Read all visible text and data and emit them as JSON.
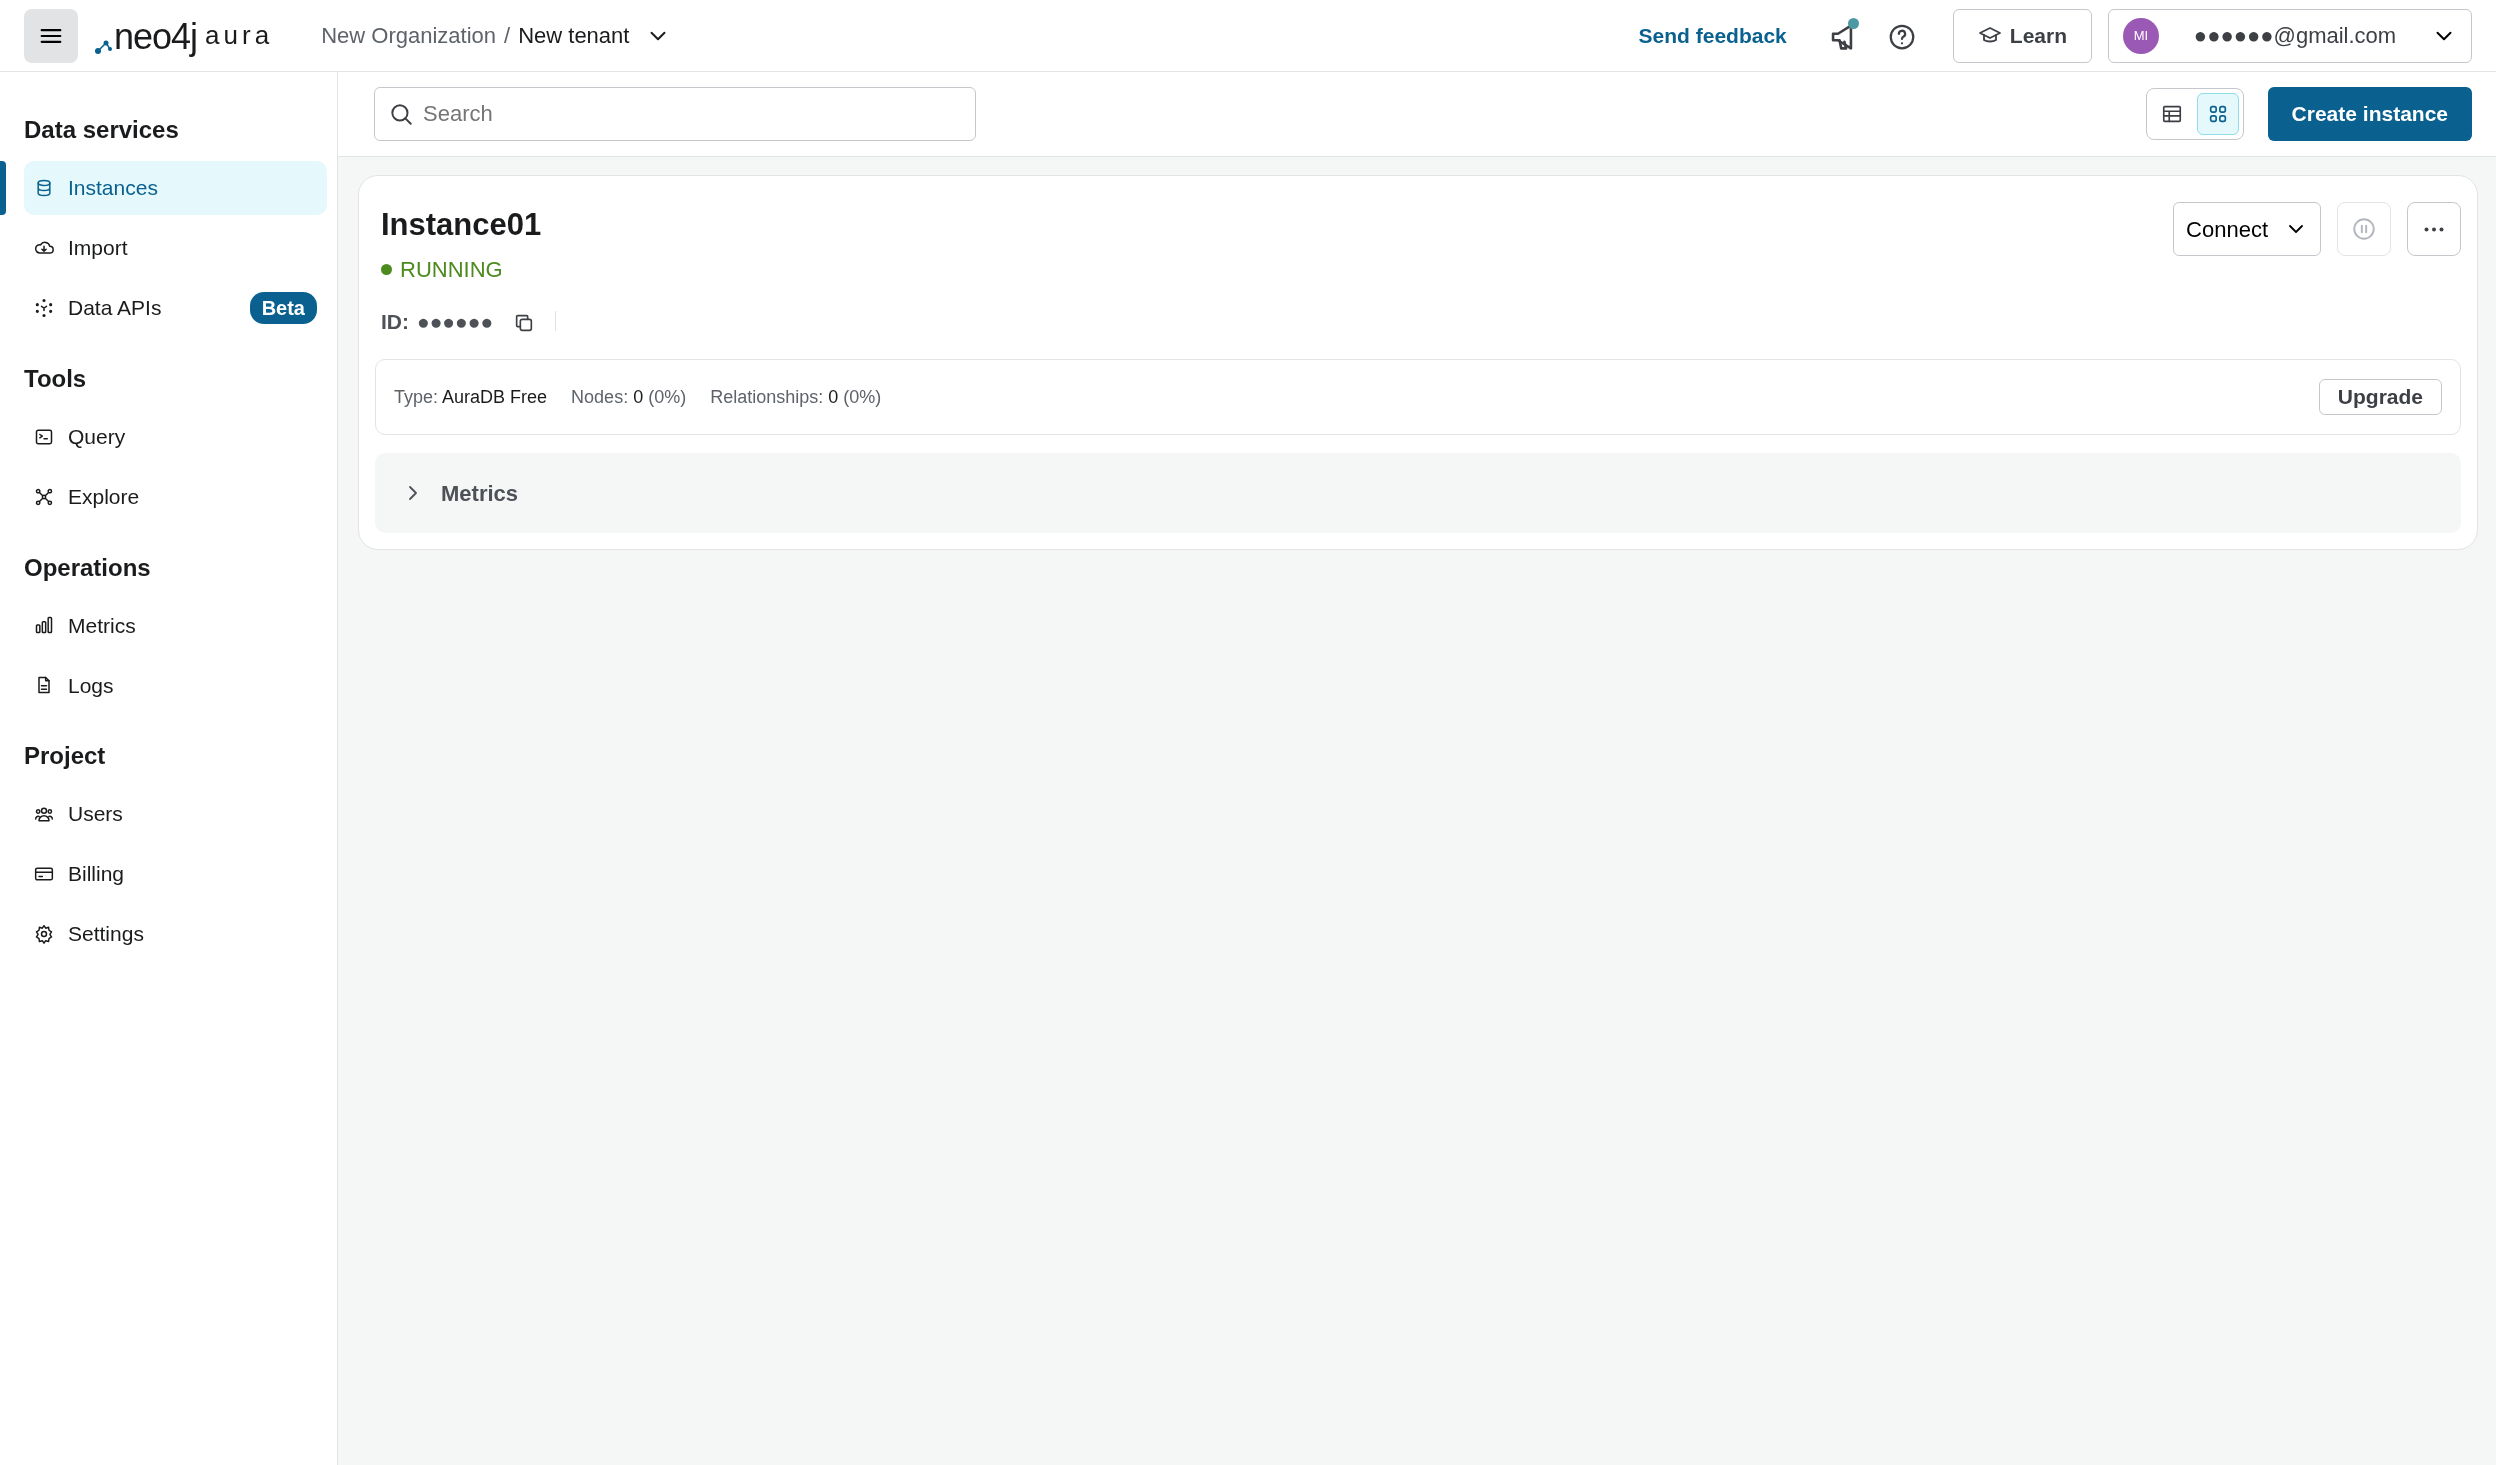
{
  "header": {
    "logo": {
      "wordmark": "neo4j",
      "product": "aura"
    },
    "breadcrumb": [
      {
        "label": "New Organization"
      },
      {
        "label": "New tenant",
        "dropdown": true
      }
    ],
    "breadcrumb_separator": "/",
    "feedback": "Send feedback",
    "notification_dot": true,
    "learn": "Learn",
    "account": {
      "initials": "MI",
      "email": "●●●●●●@gmail.com"
    }
  },
  "sidebar": [
    {
      "heading": "Data services",
      "items": [
        {
          "label": "Instances",
          "selected": true
        },
        {
          "label": "Import",
          "selected": false
        },
        {
          "label": "Data APIs",
          "selected": false,
          "badge": "Beta"
        }
      ]
    },
    {
      "heading": "Tools",
      "items": [
        {
          "label": "Query",
          "selected": false
        },
        {
          "label": "Explore",
          "selected": false
        }
      ]
    },
    {
      "heading": "Operations",
      "items": [
        {
          "label": "Metrics",
          "selected": false
        },
        {
          "label": "Logs",
          "selected": false
        }
      ]
    },
    {
      "heading": "Project",
      "items": [
        {
          "label": "Users",
          "selected": false
        },
        {
          "label": "Billing",
          "selected": false
        },
        {
          "label": "Settings",
          "selected": false
        }
      ]
    }
  ],
  "toolbar": {
    "search": {
      "placeholder": "Search"
    },
    "views": [
      {
        "kind": "table",
        "selected": false
      },
      {
        "kind": "grid",
        "selected": true
      }
    ],
    "create": "Create instance"
  },
  "instance": {
    "name": "Instance01",
    "status": "RUNNING",
    "id_label": "ID:",
    "id": "●●●●●●",
    "connect": "Connect",
    "pause_disabled": true,
    "facts": [
      {
        "label": "Type:",
        "value": "AuraDB Free"
      },
      {
        "label": "Nodes:",
        "value": "0",
        "note": "(0%)"
      },
      {
        "label": "Relationships:",
        "value": "0",
        "note": "(0%)"
      }
    ],
    "upgrade": "Upgrade",
    "metrics": {
      "label": "Metrics",
      "expanded": false
    }
  }
}
